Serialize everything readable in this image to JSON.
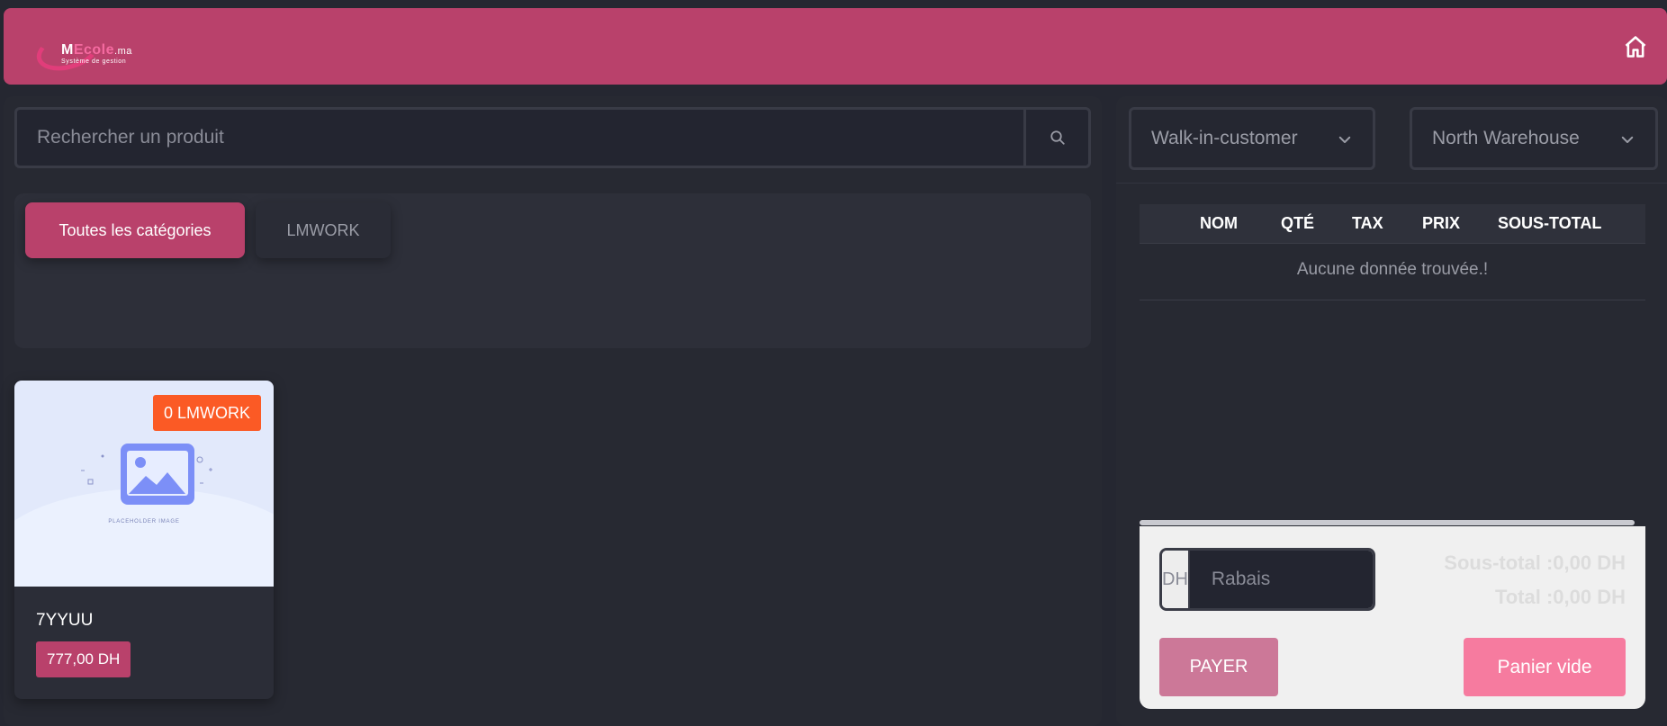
{
  "header": {
    "logo": {
      "brand_prefix": "M",
      "brand_accent": "Ecole",
      "brand_suffix": ".ma",
      "tagline": "Système de gestion"
    },
    "home_icon": "home-icon"
  },
  "search": {
    "placeholder": "Rechercher un produit",
    "icon": "search-icon"
  },
  "categories": [
    {
      "label": "Toutes les catégories",
      "active": true
    },
    {
      "label": "LMWORK",
      "active": false
    }
  ],
  "products": [
    {
      "name": "7YYUU",
      "price": "777,00 DH",
      "stock_badge": "0 LMWORK",
      "image_caption": "PLACEHOLDER IMAGE"
    }
  ],
  "cart": {
    "customer_select": "Walk-in-customer",
    "warehouse_select": "North Warehouse",
    "columns": [
      "NOM",
      "QTÉ",
      "TAX",
      "PRIX",
      "SOUS-TOTAL"
    ],
    "empty_message": "Aucune donnée trouvée.!",
    "discount_unit": "DH",
    "discount_placeholder": "Rabais",
    "subtotal": "Sous-total :0,00 DH",
    "total": "Total :0,00 DH",
    "pay_label": "PAYER",
    "empty_cart_label": "Panier vide"
  },
  "colors": {
    "brand": "#b9416b",
    "badge": "#fb5a25",
    "pay": "#cc7898",
    "empty_cart": "#f67b9f"
  }
}
